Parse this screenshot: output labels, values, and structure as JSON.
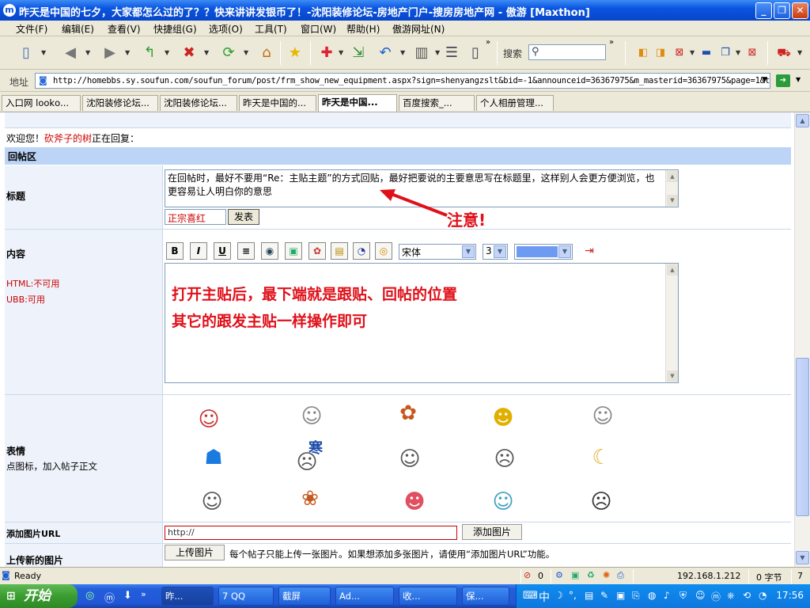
{
  "window": {
    "title": "昨天是中国的七夕，大家都怎么过的了？？快来讲讲发银币了！-沈阳装修论坛-房地产门户-搜房房地产网 - 傲游 [Maxthon]",
    "minimize": "_",
    "restore": "❐",
    "close": "✕"
  },
  "menu": [
    "文件(F)",
    "编辑(E)",
    "查看(V)",
    "快捷组(G)",
    "选项(O)",
    "工具(T)",
    "窗口(W)",
    "帮助(H)",
    "傲游网址(N)"
  ],
  "toolbar": {
    "search_label": "搜索",
    "search_value": ""
  },
  "address": {
    "label": "地址",
    "url": "http://homebbs.sy.soufun.com/soufun_forum/post/frm_show_new_equipment.aspx?sign=shenyangzslt&bid=-1&announceid=36367975&m_masterid=36367975&page=1&t"
  },
  "tabs": [
    "入口网 lookо...",
    "沈阳装修论坛...",
    "沈阳装修论坛...",
    "昨天是中国的...",
    "昨天是中国...",
    "百度搜索_...",
    "个人相册管理..."
  ],
  "form": {
    "welcome_prefix": "欢迎您！",
    "welcome_user": "砍斧子的树",
    "welcome_suffix": "正在回复：",
    "section_title": "回帖区",
    "title_label": "标题",
    "title_text": "在回帖时，最好不要用“Re：主贴主题”的方式回贴，最好把要说的主要意思写在标题里，这样别人会更方便浏览，也更容易让人明白你的意思",
    "title_color_select": "正宗喜红",
    "post_button": "发表",
    "note_callout": "注意!",
    "content_label": "内容",
    "html_status": "HTML:不可用",
    "ubb_status": "UBB:可用",
    "font_select": "宋体",
    "size_select": "3",
    "content_callout_line1": "打开主贴后，最下端就是跟贴、回帖的位置",
    "content_callout_line2": "其它的跟发主贴一样操作即可",
    "emotion_label": "表情",
    "emotion_hint": "点图标，加入帖子正文",
    "emotion_text_mark": "寒",
    "add_image_label": "添加图片URL",
    "image_url_value": "http://",
    "add_image_button": "添加图片",
    "upload_label": "上传新的图片",
    "upload_button": "上传图片",
    "upload_hint": "每个帖子只能上传一张图片。如果想添加多张图片，请使用“添加图片URL”功能。"
  },
  "editor_buttons": [
    {
      "label": "B",
      "icon": "bold-icon"
    },
    {
      "label": "I",
      "icon": "italic-icon"
    },
    {
      "label": "U",
      "icon": "underline-icon"
    },
    {
      "label": "≡",
      "icon": "center-align-icon"
    },
    {
      "label": "◉",
      "icon": "link-icon"
    },
    {
      "label": "▣",
      "icon": "image-icon"
    },
    {
      "label": "✿",
      "icon": "flash-icon"
    },
    {
      "label": "▤",
      "icon": "media-icon"
    },
    {
      "label": "◔",
      "icon": "emote-icon"
    },
    {
      "label": "◎",
      "icon": "rm-icon"
    }
  ],
  "status": {
    "ready": "Ready",
    "count": "0",
    "ip": "192.168.1.212",
    "bytes": "0 字节",
    "seven": "7"
  },
  "taskbar": {
    "start": "开始",
    "tasks": [
      "昨...",
      "7 QQ",
      "截屏",
      "Ad...",
      "收...",
      "保...",
      ""
    ],
    "ime": "中",
    "clock": "17:56"
  },
  "colors": {
    "accent_blue": "#0a55e0",
    "section_blue": "#bcd4f6",
    "callout_red": "#e0101a"
  }
}
